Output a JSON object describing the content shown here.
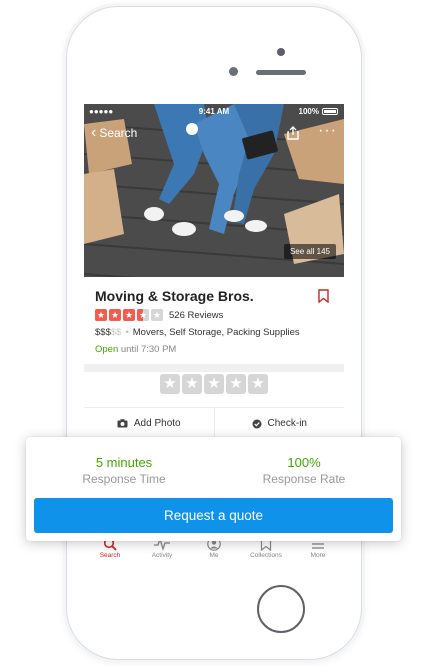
{
  "status_bar": {
    "signal": "●●●●● ",
    "time": "9:41 AM",
    "battery": "100%"
  },
  "nav": {
    "back_label": "Search",
    "more_icon": "ellipsis-icon",
    "share_icon": "share-icon"
  },
  "hero": {
    "see_all_label": "See all 145"
  },
  "business": {
    "name": "Moving & Storage Bros.",
    "rating": 3.5,
    "reviews_label": "526 Reviews",
    "price_active": "$$$",
    "price_inactive": "$$",
    "categories": "Movers, Self Storage, Packing Supplies",
    "open_label": "Open",
    "hours_label": "until 7:30 PM"
  },
  "actions": [
    {
      "label": "Add Photo",
      "icon": "camera-icon"
    },
    {
      "label": "Check-in",
      "icon": "check-in-icon"
    }
  ],
  "tabs": [
    {
      "label": "Search",
      "icon": "search-icon",
      "active": true
    },
    {
      "label": "Activity",
      "icon": "activity-icon",
      "active": false
    },
    {
      "label": "Me",
      "icon": "profile-icon",
      "active": false
    },
    {
      "label": "Collections",
      "icon": "bookmark-icon",
      "active": false
    },
    {
      "label": "More",
      "icon": "menu-icon",
      "active": false
    }
  ],
  "quote_card": {
    "response_time_value": "5 minutes",
    "response_time_label": "Response Time",
    "response_rate_value": "100%",
    "response_rate_label": "Response Rate",
    "button_label": "Request a quote"
  },
  "colors": {
    "accent_red": "#d32323",
    "star_red": "#f15c4f",
    "green": "#41a700",
    "button_blue": "#0f93ea"
  }
}
